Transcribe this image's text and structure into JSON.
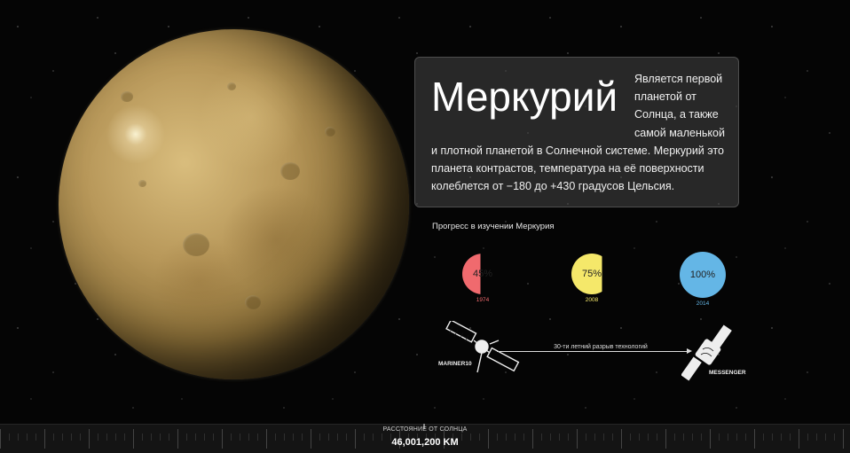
{
  "planet": {
    "name": "Меркурий",
    "description": "Является первой планетой от Солнца, а также самой маленькой и плотной планетой в Солнечной системе. Меркурий это планета контрастов, температура на её поверхности колеблется от −180 до +430 градусов Цельсия."
  },
  "progress": {
    "title": "Прогресс в изучении Меркурия",
    "items": [
      {
        "value": 45,
        "label": "45%",
        "year": "1974",
        "color": "#f06a6e"
      },
      {
        "value": 75,
        "label": "75%",
        "year": "2008",
        "color": "#f5e86a"
      },
      {
        "value": 100,
        "label": "100%",
        "year": "2014",
        "color": "#64b6e6"
      }
    ]
  },
  "missions": {
    "gap_label": "30-ти летний разрыв технологий",
    "first": "MARINER10",
    "second": "MESSENGER"
  },
  "distance": {
    "label": "РАССТОЯНИЕ ОТ СОЛНЦА",
    "value": "46,001,200  KM"
  }
}
